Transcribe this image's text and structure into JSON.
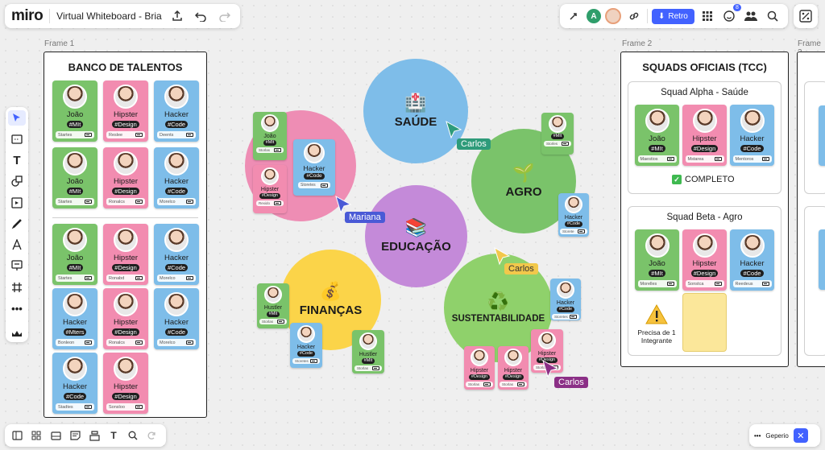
{
  "topbar": {
    "logo": "miro",
    "board_title": "Virtual Whiteboard - Bria",
    "user_initial": "A",
    "retro_label": "Retro",
    "notification_count": "8"
  },
  "colors": {
    "accent": "#4262ff",
    "green": "#7ac36a",
    "pink": "#f28cb0",
    "blue": "#7ebde9"
  },
  "frames": {
    "frame1_label": "Frame 1",
    "frame2_label": "Frame 2",
    "frame3_label": "Frame 3",
    "banco_title": "BANCO DE TALENTOS",
    "squads_title": "SQUADS OFICIAIS (TCC)",
    "squad_alpha": "Squad Alpha - Saúde",
    "squad_beta": "Squad Beta - Agro",
    "completo": "COMPLETO",
    "precisa": "Precisa de 1 Integrante"
  },
  "banco_cards": [
    {
      "name": "João",
      "tag": "#MIt",
      "foot": "Startes"
    },
    {
      "name": "Hipster",
      "tag": "#Design",
      "foot": "Reslee"
    },
    {
      "name": "Hacker",
      "tag": "#Code",
      "foot": "Deents"
    },
    {
      "name": "João",
      "tag": "#MIt",
      "foot": "Startes"
    },
    {
      "name": "Hipster",
      "tag": "#Design",
      "foot": "Ronalcs"
    },
    {
      "name": "Hacker",
      "tag": "#Code",
      "foot": "Morelco"
    },
    {
      "name": "João",
      "tag": "#MIt",
      "foot": "Startes"
    },
    {
      "name": "Hipster",
      "tag": "#Design",
      "foot": "Ronabd"
    },
    {
      "name": "Hacker",
      "tag": "#Code",
      "foot": "Morelco"
    },
    {
      "name": "Hacker",
      "tag": "#Mters",
      "foot": "Bonleon"
    },
    {
      "name": "Hipster",
      "tag": "#Design",
      "foot": "Ronalcs"
    },
    {
      "name": "Hacker",
      "tag": "#Code",
      "foot": "Morelco"
    },
    {
      "name": "Hacker",
      "tag": "#Code",
      "foot": "Stadtes"
    },
    {
      "name": "Hipster",
      "tag": "#Design",
      "foot": "Sonsloo"
    }
  ],
  "circles": {
    "saude": "SAÚDE",
    "agro": "AGRO",
    "educacao": "EDUCAÇÃO",
    "financas": "FINANÇAS",
    "sustentabilidade": "SUSTENTABILIDADE"
  },
  "float_cards": {
    "saude_joao": {
      "name": "João",
      "tag": "#MIt",
      "foot": "Storlas"
    },
    "saude_hipster": {
      "name": "Hipster",
      "tag": "#Design",
      "foot": "Rexido"
    },
    "saude_hacker": {
      "name": "Hacker",
      "tag": "#Code",
      "foot": "Storetes"
    },
    "agro_1": {
      "name": "",
      "tag": "#MIt",
      "foot": "Storles"
    },
    "agro_hacker": {
      "name": "Hacker",
      "tag": "#Code",
      "foot": "Storete"
    },
    "fin_hustler": {
      "name": "Hustler",
      "tag": "#MIt",
      "foot": "Storlas"
    },
    "fin_hacker": {
      "name": "Hacker",
      "tag": "#Code",
      "foot": "Storetes"
    },
    "fin_hustler2": {
      "name": "Hustler",
      "tag": "#MIt",
      "foot": "Storlas"
    },
    "sus_hacker": {
      "name": "Hacker",
      "tag": "#Code",
      "foot": "Storetes"
    },
    "sus_hipster1": {
      "name": "Hipster",
      "tag": "#Design",
      "foot": "Storlas"
    },
    "sus_hipster2": {
      "name": "Hipster",
      "tag": "#Design",
      "foot": "Storlas"
    },
    "sus_hipster3": {
      "name": "Hipster",
      "tag": "#Design",
      "foot": "Storlas"
    }
  },
  "alpha_cards": [
    {
      "name": "João",
      "tag": "#MIt",
      "foot": "Maestios"
    },
    {
      "name": "Hipster",
      "tag": "#Design",
      "foot": "Mstarea"
    },
    {
      "name": "Hacker",
      "tag": "#Code",
      "foot": "Mentoros"
    }
  ],
  "beta_cards": [
    {
      "name": "João",
      "tag": "#MIt",
      "foot": "Morelles"
    },
    {
      "name": "Hipster",
      "tag": "#Design",
      "foot": "Sonstca"
    },
    {
      "name": "Hacker",
      "tag": "#Code",
      "foot": "Reedeus"
    }
  ],
  "cursors": {
    "carlos": "Carlos",
    "mariana": "Mariana"
  },
  "bottom": {
    "right_label": "Geperio"
  },
  "icons": [
    "select-icon",
    "sticky-note-icon",
    "text-icon",
    "shape-icon",
    "frame-icon",
    "pen-icon",
    "connector-icon",
    "comment-icon",
    "grid-icon",
    "more-icon",
    "apps-icon"
  ]
}
